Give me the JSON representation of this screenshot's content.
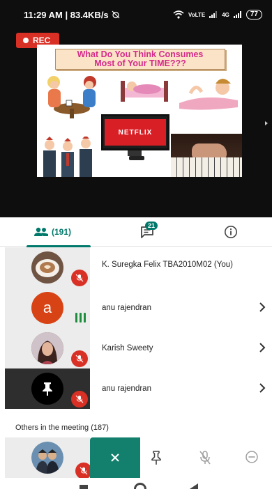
{
  "status_bar": {
    "time_speed": "11:29 AM | 83.4KB/s",
    "network_1": "VoLTE",
    "network_2": "4G",
    "battery": "77"
  },
  "video": {
    "rec_label": "REC",
    "slide": {
      "title_line1": "What Do You Think Consumes",
      "title_line2": "Most of Your TIME???",
      "tv_brand": "NETFLIX"
    }
  },
  "tabs": {
    "people_count": "(191)",
    "chat_badge": "21"
  },
  "participants": [
    {
      "name": "K. Suregka Felix TBA2010M02 (You)",
      "avatar": "coffee-photo",
      "state": "muted"
    },
    {
      "name": "anu rajendran",
      "avatar": "letter-a",
      "avatar_letter": "a",
      "state": "speaking"
    },
    {
      "name": "Karish Sweety",
      "avatar": "portrait-photo",
      "state": "muted"
    },
    {
      "name": "anu rajendran",
      "avatar": "pin-icon",
      "state": "muted-pinned"
    }
  ],
  "others_label": "Others in the meeting (187)",
  "colors": {
    "accent": "#00796B",
    "action_green": "#12806C",
    "mute_red": "#D93025",
    "avatar_orange": "#D84315"
  }
}
